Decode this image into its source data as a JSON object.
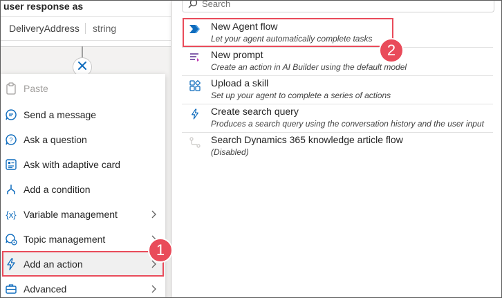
{
  "node": {
    "title": "user response as",
    "variable_name": "DeliveryAddress",
    "variable_type": "string"
  },
  "left_menu": {
    "items": [
      {
        "label": "Paste",
        "icon": "paste-icon",
        "disabled": true
      },
      {
        "label": "Send a message",
        "icon": "message-icon"
      },
      {
        "label": "Ask a question",
        "icon": "question-icon"
      },
      {
        "label": "Ask with adaptive card",
        "icon": "adaptive-card-icon"
      },
      {
        "label": "Add a condition",
        "icon": "condition-icon"
      },
      {
        "label": "Variable management",
        "icon": "variable-icon",
        "submenu": true
      },
      {
        "label": "Topic management",
        "icon": "topic-icon",
        "submenu": true
      },
      {
        "label": "Add an action",
        "icon": "lightning-icon",
        "submenu": true,
        "selected": true
      },
      {
        "label": "Advanced",
        "icon": "briefcase-icon",
        "submenu": true
      }
    ]
  },
  "right_panel": {
    "search_placeholder": "Search",
    "actions": [
      {
        "title": "New Agent flow",
        "description": "Let your agent automatically complete tasks",
        "icon": "power-automate-icon"
      },
      {
        "title": "New prompt",
        "description": "Create an action in AI Builder using the default model",
        "icon": "prompt-icon"
      },
      {
        "title": "Upload a skill",
        "description": "Set up your agent to complete a series of actions",
        "icon": "skill-icon"
      },
      {
        "title": "Create search query",
        "description": "Produces a search query using the conversation history and the user input",
        "icon": "lightning-icon"
      },
      {
        "title": "Search Dynamics 365 knowledge article flow",
        "description": "(Disabled)",
        "icon": "flow-icon"
      }
    ]
  },
  "badges": {
    "one": "1",
    "two": "2"
  },
  "colors": {
    "callout": "#e94b5a",
    "accent": "#0f6cbd"
  }
}
